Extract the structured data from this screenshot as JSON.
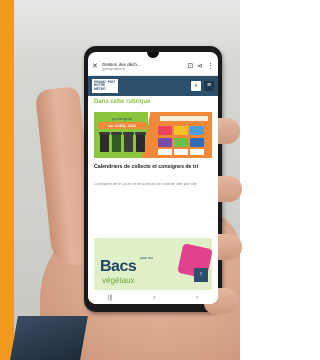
{
  "scene": {
    "frame_color": "#f39a1e",
    "description_colors": {
      "skin": "#dcaa8e",
      "phone": "#1a1a1c",
      "wall": "#d4d4d0"
    }
  },
  "browser": {
    "close_icon": "close-icon",
    "page_title": "Gestion des déch...",
    "page_url": "grandpoitiers.fr",
    "bookmark_icon": "bookmark-icon",
    "share_icon": "share-icon",
    "menu_icon": "more-vert-icon"
  },
  "site": {
    "logo_text": "GRAND ◦POIT NOTRE MÉTRO",
    "search_icon": "search-icon",
    "menu_icon": "hamburger-icon",
    "section_heading": "Dans cette rubrique",
    "banner_text": "ça change au",
    "banner_date": "1er AVRIL 2022",
    "card_title": "Calendriers de collecte et consignes de tri",
    "card_description": "Consignes de tri, jours et fréquences de collecte ville par ville",
    "card2_big": "Bacs",
    "card2_small": "pour vos",
    "card2_sub": "végétaux",
    "scroll_top_icon": "arrow-up-icon"
  },
  "navbar": {
    "recent_icon": "recents-icon",
    "home_icon": "home-icon",
    "back_icon": "back-icon",
    "recent_glyph": "|||",
    "home_glyph": "○",
    "back_glyph": "‹"
  }
}
